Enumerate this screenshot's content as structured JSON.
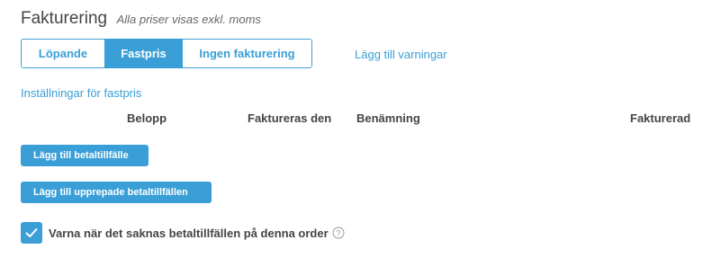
{
  "header": {
    "title": "Fakturering",
    "subtitle": "Alla priser visas exkl. moms"
  },
  "billing_tabs": [
    {
      "label": "Löpande",
      "active": false
    },
    {
      "label": "Fastpris",
      "active": true
    },
    {
      "label": "Ingen fakturering",
      "active": false
    }
  ],
  "add_warnings_link": "Lägg till varningar",
  "settings_link": "Inställningar för fastpris",
  "table": {
    "columns": [
      "Belopp",
      "Faktureras den",
      "Benämning",
      "Fakturerad"
    ]
  },
  "buttons": {
    "add_payment": "Lägg till betaltillfälle",
    "add_recurring": "Lägg till upprepade betaltillfällen"
  },
  "warn_checkbox": {
    "label": "Varna när det saknas betaltillfällen på denna order",
    "checked": true
  },
  "icons": {
    "check": "check-icon",
    "help": "question-circle-icon"
  },
  "colors": {
    "accent": "#3a9fd6",
    "text": "#444444"
  }
}
